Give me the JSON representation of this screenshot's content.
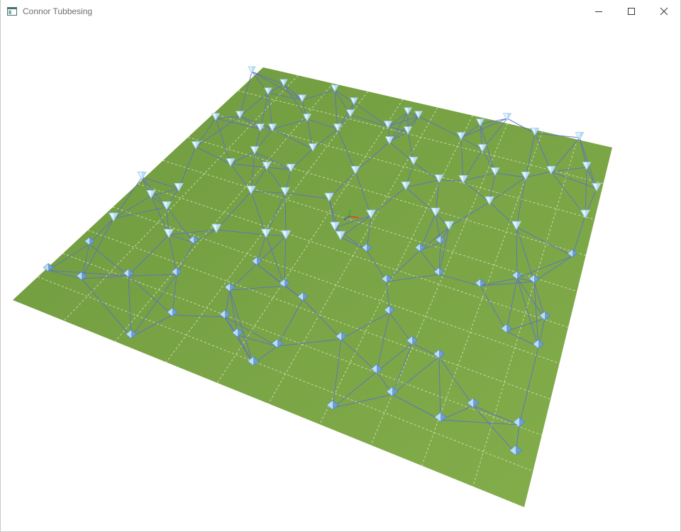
{
  "window": {
    "title": "Connor Tubbesing",
    "icon": "app-window-icon",
    "buttons": [
      {
        "name": "minimize-button",
        "icon": "minimize-icon"
      },
      {
        "name": "maximize-button",
        "icon": "maximize-icon"
      },
      {
        "name": "close-button",
        "icon": "close-icon"
      }
    ]
  },
  "scene": {
    "description_free": "",
    "colors": {
      "ground": "#7aa346",
      "grid": "#dfe9cf",
      "edge": "#5d6fc7",
      "node_light": "#dff8fb",
      "node_mid": "#9cc8ee",
      "node_dark": "#4f83c4",
      "axis_x": "#e23a2c",
      "axis_y": "#2ea84a",
      "axis_z": "#3a55d6"
    },
    "node_count": 104
  }
}
